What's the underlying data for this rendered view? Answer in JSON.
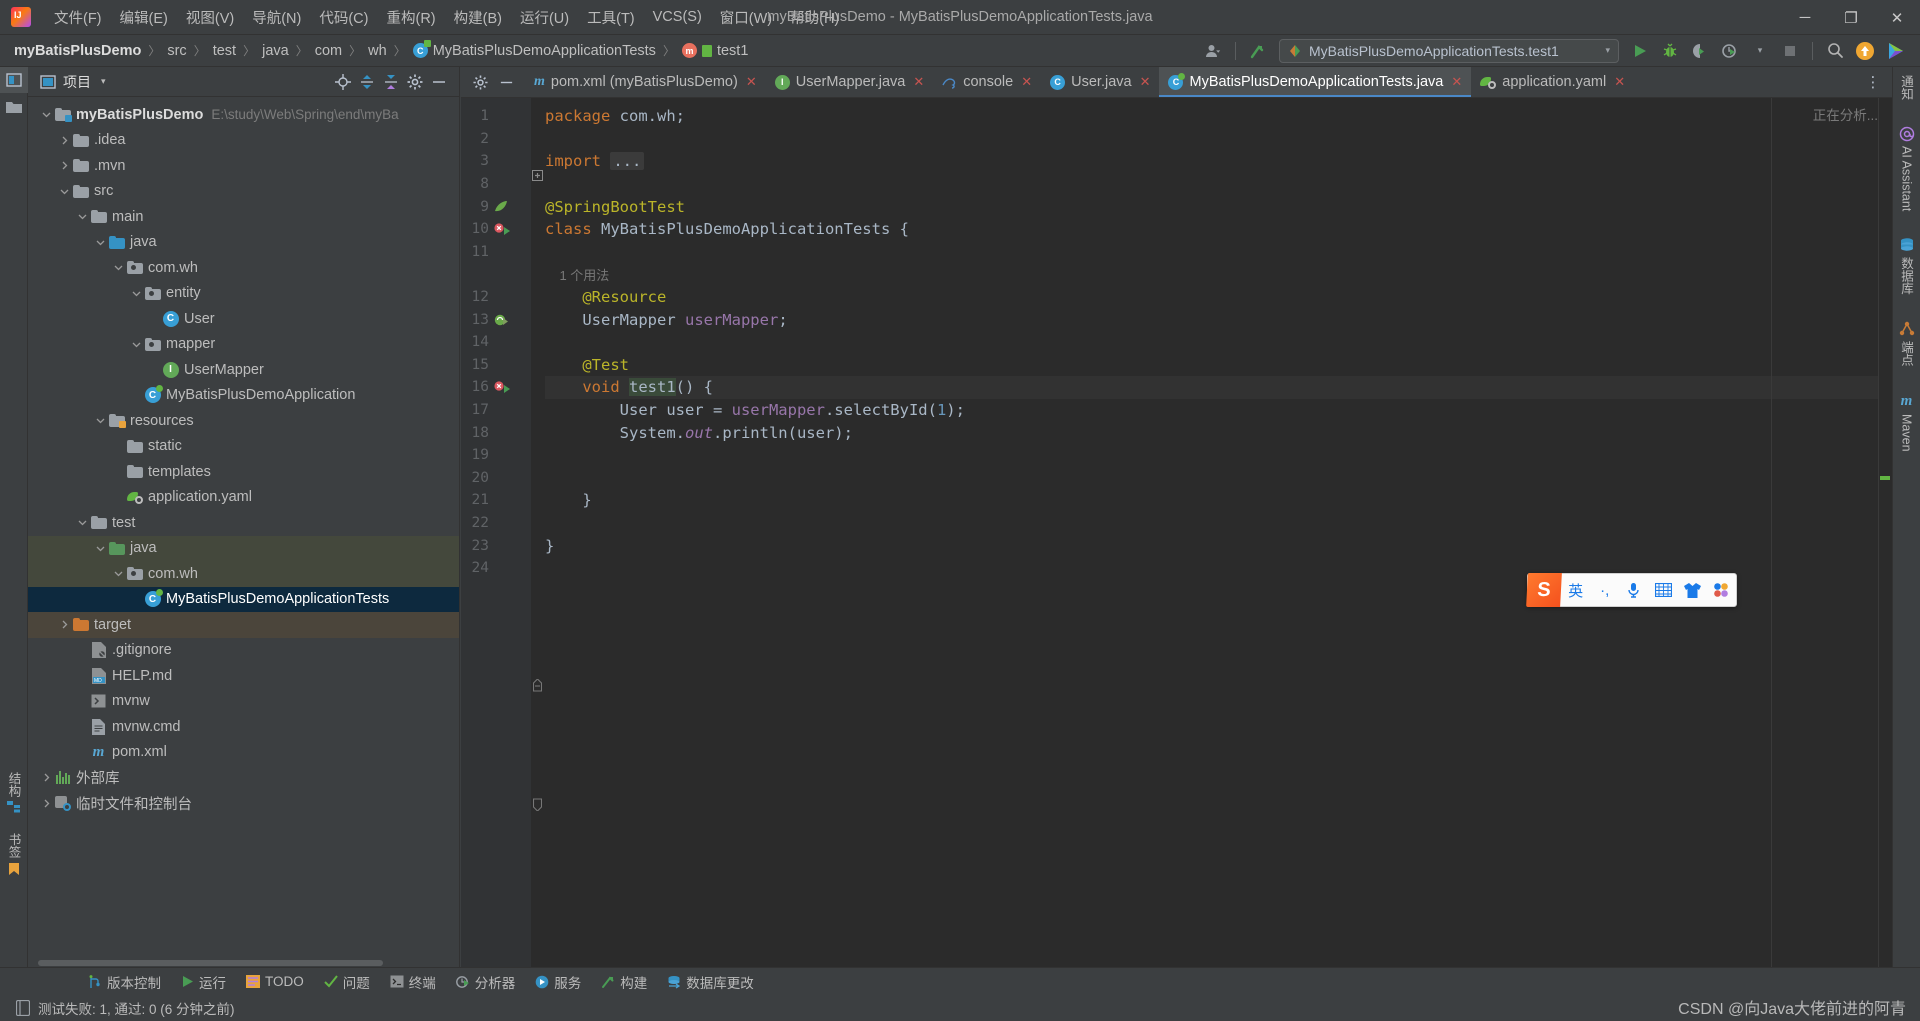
{
  "window": {
    "title": "myBatisPlusDemo - MyBatisPlusDemoApplicationTests.java",
    "minimize": "─",
    "maximize": "❐",
    "close": "✕"
  },
  "menu": {
    "items": [
      {
        "label": "文件(F)"
      },
      {
        "label": "编辑(E)"
      },
      {
        "label": "视图(V)"
      },
      {
        "label": "导航(N)"
      },
      {
        "label": "代码(C)"
      },
      {
        "label": "重构(R)"
      },
      {
        "label": "构建(B)"
      },
      {
        "label": "运行(U)"
      },
      {
        "label": "工具(T)"
      },
      {
        "label": "VCS(S)"
      },
      {
        "label": "窗口(W)"
      },
      {
        "label": "帮助(H)"
      }
    ]
  },
  "navbar": {
    "crumbs": [
      "myBatisPlusDemo",
      "src",
      "test",
      "java",
      "com",
      "wh",
      "MyBatisPlusDemoApplicationTests",
      "test1"
    ],
    "separator": "〉",
    "class_badge": "C",
    "method_badge": "m",
    "run_config": "MyBatisPlusDemoApplicationTests.test1",
    "run_config_caret": "▾",
    "buttons": {
      "profile_caret": "▾",
      "run": "run-button",
      "debug": "debug-button",
      "coverage": "coverage-button",
      "profiler": "profiler-button",
      "stop": "stop-button",
      "search": "search-button",
      "updates": "updates-button",
      "ai": "ai-button"
    }
  },
  "left_strip": {
    "project_label": "项目",
    "structure_label": "结构",
    "bookmarks_label": "书签"
  },
  "right_strip": {
    "items": [
      {
        "label": "通知",
        "icon": "bell-icon"
      },
      {
        "label": "AI Assistant",
        "icon": "at-icon"
      },
      {
        "label": "数据库",
        "icon": "database-icon"
      },
      {
        "label": "端点",
        "icon": "endpoints-icon"
      },
      {
        "label": "Maven",
        "icon": "maven-icon"
      }
    ]
  },
  "project_panel": {
    "title": "项目",
    "caret": "▾",
    "actions": [
      "locate-icon",
      "expand-all-icon",
      "collapse-all-icon",
      "settings-icon",
      "hide-icon"
    ],
    "tree": [
      {
        "label": "myBatisPlusDemo",
        "path": "E:\\study\\Web\\Spring\\end\\myBa",
        "indent": 0,
        "arrow": "⌄",
        "icon": "module-folder",
        "bold": true
      },
      {
        "label": ".idea",
        "indent": 1,
        "arrow": "›",
        "icon": "folder"
      },
      {
        "label": ".mvn",
        "indent": 1,
        "arrow": "›",
        "icon": "folder"
      },
      {
        "label": "src",
        "indent": 1,
        "arrow": "⌄",
        "icon": "folder"
      },
      {
        "label": "main",
        "indent": 2,
        "arrow": "⌄",
        "icon": "folder"
      },
      {
        "label": "java",
        "indent": 3,
        "arrow": "⌄",
        "icon": "folder-blue"
      },
      {
        "label": "com.wh",
        "indent": 4,
        "arrow": "⌄",
        "icon": "package"
      },
      {
        "label": "entity",
        "indent": 5,
        "arrow": "⌄",
        "icon": "package"
      },
      {
        "label": "User",
        "indent": 6,
        "arrow": "",
        "icon": "class"
      },
      {
        "label": "mapper",
        "indent": 5,
        "arrow": "⌄",
        "icon": "package"
      },
      {
        "label": "UserMapper",
        "indent": 6,
        "arrow": "",
        "icon": "interface"
      },
      {
        "label": "MyBatisPlusDemoApplication",
        "indent": 5,
        "arrow": "",
        "icon": "spring-class"
      },
      {
        "label": "resources",
        "indent": 3,
        "arrow": "⌄",
        "icon": "folder-resources"
      },
      {
        "label": "static",
        "indent": 4,
        "arrow": "",
        "icon": "folder"
      },
      {
        "label": "templates",
        "indent": 4,
        "arrow": "",
        "icon": "folder"
      },
      {
        "label": "application.yaml",
        "indent": 4,
        "arrow": "",
        "icon": "yaml"
      },
      {
        "label": "test",
        "indent": 2,
        "arrow": "⌄",
        "icon": "folder"
      },
      {
        "label": "java",
        "indent": 3,
        "arrow": "⌄",
        "icon": "folder-green",
        "rowstyle": "srcroot-test"
      },
      {
        "label": "com.wh",
        "indent": 4,
        "arrow": "⌄",
        "icon": "package",
        "rowstyle": "srcroot-test"
      },
      {
        "label": "MyBatisPlusDemoApplicationTests",
        "indent": 5,
        "arrow": "",
        "icon": "spring-class",
        "rowstyle": "sel"
      },
      {
        "label": "target",
        "indent": 1,
        "arrow": "›",
        "icon": "folder-orange",
        "rowstyle": "mod"
      },
      {
        "label": ".gitignore",
        "indent": 2,
        "arrow": "",
        "icon": "gitignore"
      },
      {
        "label": "HELP.md",
        "indent": 2,
        "arrow": "",
        "icon": "markdown"
      },
      {
        "label": "mvnw",
        "indent": 2,
        "arrow": "",
        "icon": "script"
      },
      {
        "label": "mvnw.cmd",
        "indent": 2,
        "arrow": "",
        "icon": "cmd"
      },
      {
        "label": "pom.xml",
        "indent": 2,
        "arrow": "",
        "icon": "maven"
      },
      {
        "label": "外部库",
        "indent": 0,
        "arrow": "›",
        "icon": "libraries"
      },
      {
        "label": "临时文件和控制台",
        "indent": 0,
        "arrow": "›",
        "icon": "scratches"
      }
    ]
  },
  "editor": {
    "tabs": [
      {
        "label": "pom.xml (myBatisPlusDemo)",
        "icon": "maven-icon",
        "active": false,
        "close": "✕"
      },
      {
        "label": "UserMapper.java",
        "icon": "interface-icon",
        "active": false,
        "close": "✕"
      },
      {
        "label": "console",
        "icon": "mysql-icon",
        "active": false,
        "close": "✕"
      },
      {
        "label": "User.java",
        "icon": "class-icon",
        "active": false,
        "close": "✕"
      },
      {
        "label": "MyBatisPlusDemoApplicationTests.java",
        "icon": "spring-test-icon",
        "active": true,
        "close": "✕"
      },
      {
        "label": "application.yaml",
        "icon": "yaml-icon",
        "active": false,
        "close": "✕"
      }
    ],
    "more_tabs": "⋮",
    "analyzing": "正在分析...",
    "line_numbers": [
      "1",
      "2",
      "3",
      "8",
      "9",
      "10",
      "11",
      "12",
      "13",
      "14",
      "15",
      "16",
      "17",
      "18",
      "19",
      "20",
      "21",
      "22",
      "23",
      "24"
    ],
    "lines": [
      {
        "n": "1",
        "tokens": [
          {
            "t": "package ",
            "c": "k"
          },
          {
            "t": "com.wh",
            "c": "cl"
          },
          {
            "t": ";",
            "c": "st"
          }
        ]
      },
      {
        "n": "2",
        "tokens": []
      },
      {
        "n": "3",
        "tokens": [
          {
            "t": "import ",
            "c": "k"
          },
          {
            "t": "...",
            "c": "fold"
          }
        ]
      },
      {
        "n": "8",
        "tokens": []
      },
      {
        "n": "9",
        "tokens": [
          {
            "t": "@SpringBootTest",
            "c": "an"
          }
        ],
        "gutter": "spring-leaf"
      },
      {
        "n": "10",
        "tokens": [
          {
            "t": "class ",
            "c": "k"
          },
          {
            "t": "MyBatisPlusDemoApplicationTests {",
            "c": "cl"
          }
        ],
        "gutter": "test-failed-run"
      },
      {
        "n": "11",
        "tokens": []
      },
      {
        "n": "",
        "tokens": [
          {
            "t": "    1 个用法",
            "c": "hint"
          }
        ],
        "hintline": true
      },
      {
        "n": "12",
        "tokens": [
          {
            "t": "    @Resource",
            "c": "an"
          }
        ]
      },
      {
        "n": "13",
        "tokens": [
          {
            "t": "    UserMapper ",
            "c": "cl"
          },
          {
            "t": "userMapper",
            "c": "fld"
          },
          {
            "t": ";",
            "c": "st"
          }
        ],
        "gutter": "bean-inject"
      },
      {
        "n": "14",
        "tokens": []
      },
      {
        "n": "15",
        "tokens": [
          {
            "t": "    @Test",
            "c": "an"
          }
        ]
      },
      {
        "n": "16",
        "tokens": [
          {
            "t": "    ",
            "c": "st"
          },
          {
            "t": "void ",
            "c": "k"
          },
          {
            "t": "test1",
            "c": "sel"
          },
          {
            "t": "() {",
            "c": "st"
          }
        ],
        "current": true,
        "gutter": "test-failed-run"
      },
      {
        "n": "17",
        "tokens": [
          {
            "t": "        User user = ",
            "c": "cl"
          },
          {
            "t": "userMapper",
            "c": "fld"
          },
          {
            "t": ".selectById(",
            "c": "cl"
          },
          {
            "t": "1",
            "c": "num"
          },
          {
            "t": ");",
            "c": "st"
          }
        ]
      },
      {
        "n": "18",
        "tokens": [
          {
            "t": "        System.",
            "c": "cl"
          },
          {
            "t": "out",
            "c": "it"
          },
          {
            "t": ".println(user);",
            "c": "cl"
          }
        ]
      },
      {
        "n": "19",
        "tokens": []
      },
      {
        "n": "20",
        "tokens": []
      },
      {
        "n": "21",
        "tokens": [
          {
            "t": "    }",
            "c": "st"
          }
        ]
      },
      {
        "n": "22",
        "tokens": []
      },
      {
        "n": "23",
        "tokens": [
          {
            "t": "}",
            "c": "st"
          }
        ]
      },
      {
        "n": "24",
        "tokens": []
      }
    ]
  },
  "ime": {
    "logo": "S",
    "mode": "英",
    "punctuation": "·,",
    "mic": "mic-icon",
    "keyboard": "keyboard-icon",
    "skin": "skin-icon",
    "apps": "apps-icon"
  },
  "status": {
    "buttons": [
      {
        "label": "版本控制",
        "icon": "vcs-icon"
      },
      {
        "label": "运行",
        "icon": "run-icon"
      },
      {
        "label": "TODO",
        "icon": "todo-icon"
      },
      {
        "label": "问题",
        "icon": "problems-icon"
      },
      {
        "label": "终端",
        "icon": "terminal-icon"
      },
      {
        "label": "分析器",
        "icon": "profiler-icon"
      },
      {
        "label": "服务",
        "icon": "services-icon"
      },
      {
        "label": "构建",
        "icon": "build-icon"
      },
      {
        "label": "数据库更改",
        "icon": "db-changes-icon"
      }
    ],
    "message": "测试失败: 1, 通过: 0 (6 分钟之前)",
    "message_icon": "test-results-icon"
  },
  "watermark": "CSDN @向Java大佬前进的阿青"
}
